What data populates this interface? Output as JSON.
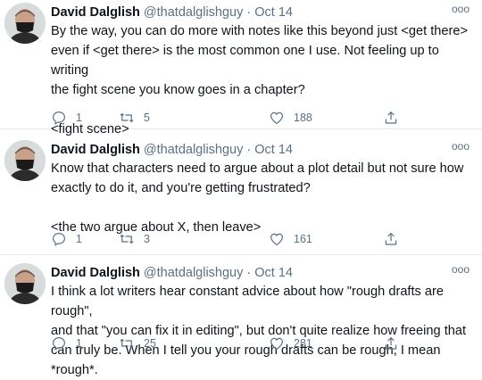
{
  "tweets": [
    {
      "author_name": "David Dalglish",
      "handle": "@thatdalglishguy",
      "separator": "·",
      "date": "Oct 14",
      "text": "By the way, you can do more with notes like this beyond just <get there>\neven if <get there> is the most common one I use. Not feeling up to writing\nthe fight scene you know goes in a chapter?\n\n<fight scene>",
      "replies": "1",
      "retweets": "5",
      "likes": "188",
      "more": "ooo"
    },
    {
      "author_name": "David Dalglish",
      "handle": "@thatdalglishguy",
      "separator": "·",
      "date": "Oct 14",
      "text": "Know that characters need to argue about a plot detail but not sure how\nexactly to do it, and you're getting frustrated?\n\n<the two argue about X, then leave>",
      "replies": "1",
      "retweets": "3",
      "likes": "161",
      "more": "ooo"
    },
    {
      "author_name": "David Dalglish",
      "handle": "@thatdalglishguy",
      "separator": "·",
      "date": "Oct 14",
      "text": "I think a lot writers hear constant advice about how \"rough drafts are rough\",\nand that \"you can fix it in editing\", but don't quite realize how freeing that\ncan truly be. When I tell you your rough drafts can be rough, I mean *rough*.",
      "replies": "1",
      "retweets": "25",
      "likes": "281",
      "more": "ooo"
    }
  ],
  "colors": {
    "text": "#0f1419",
    "secondary": "#5b7083",
    "divider": "#e6ecf0"
  },
  "icons": [
    "reply-icon",
    "retweet-icon",
    "like-icon",
    "share-icon",
    "more-icon"
  ]
}
